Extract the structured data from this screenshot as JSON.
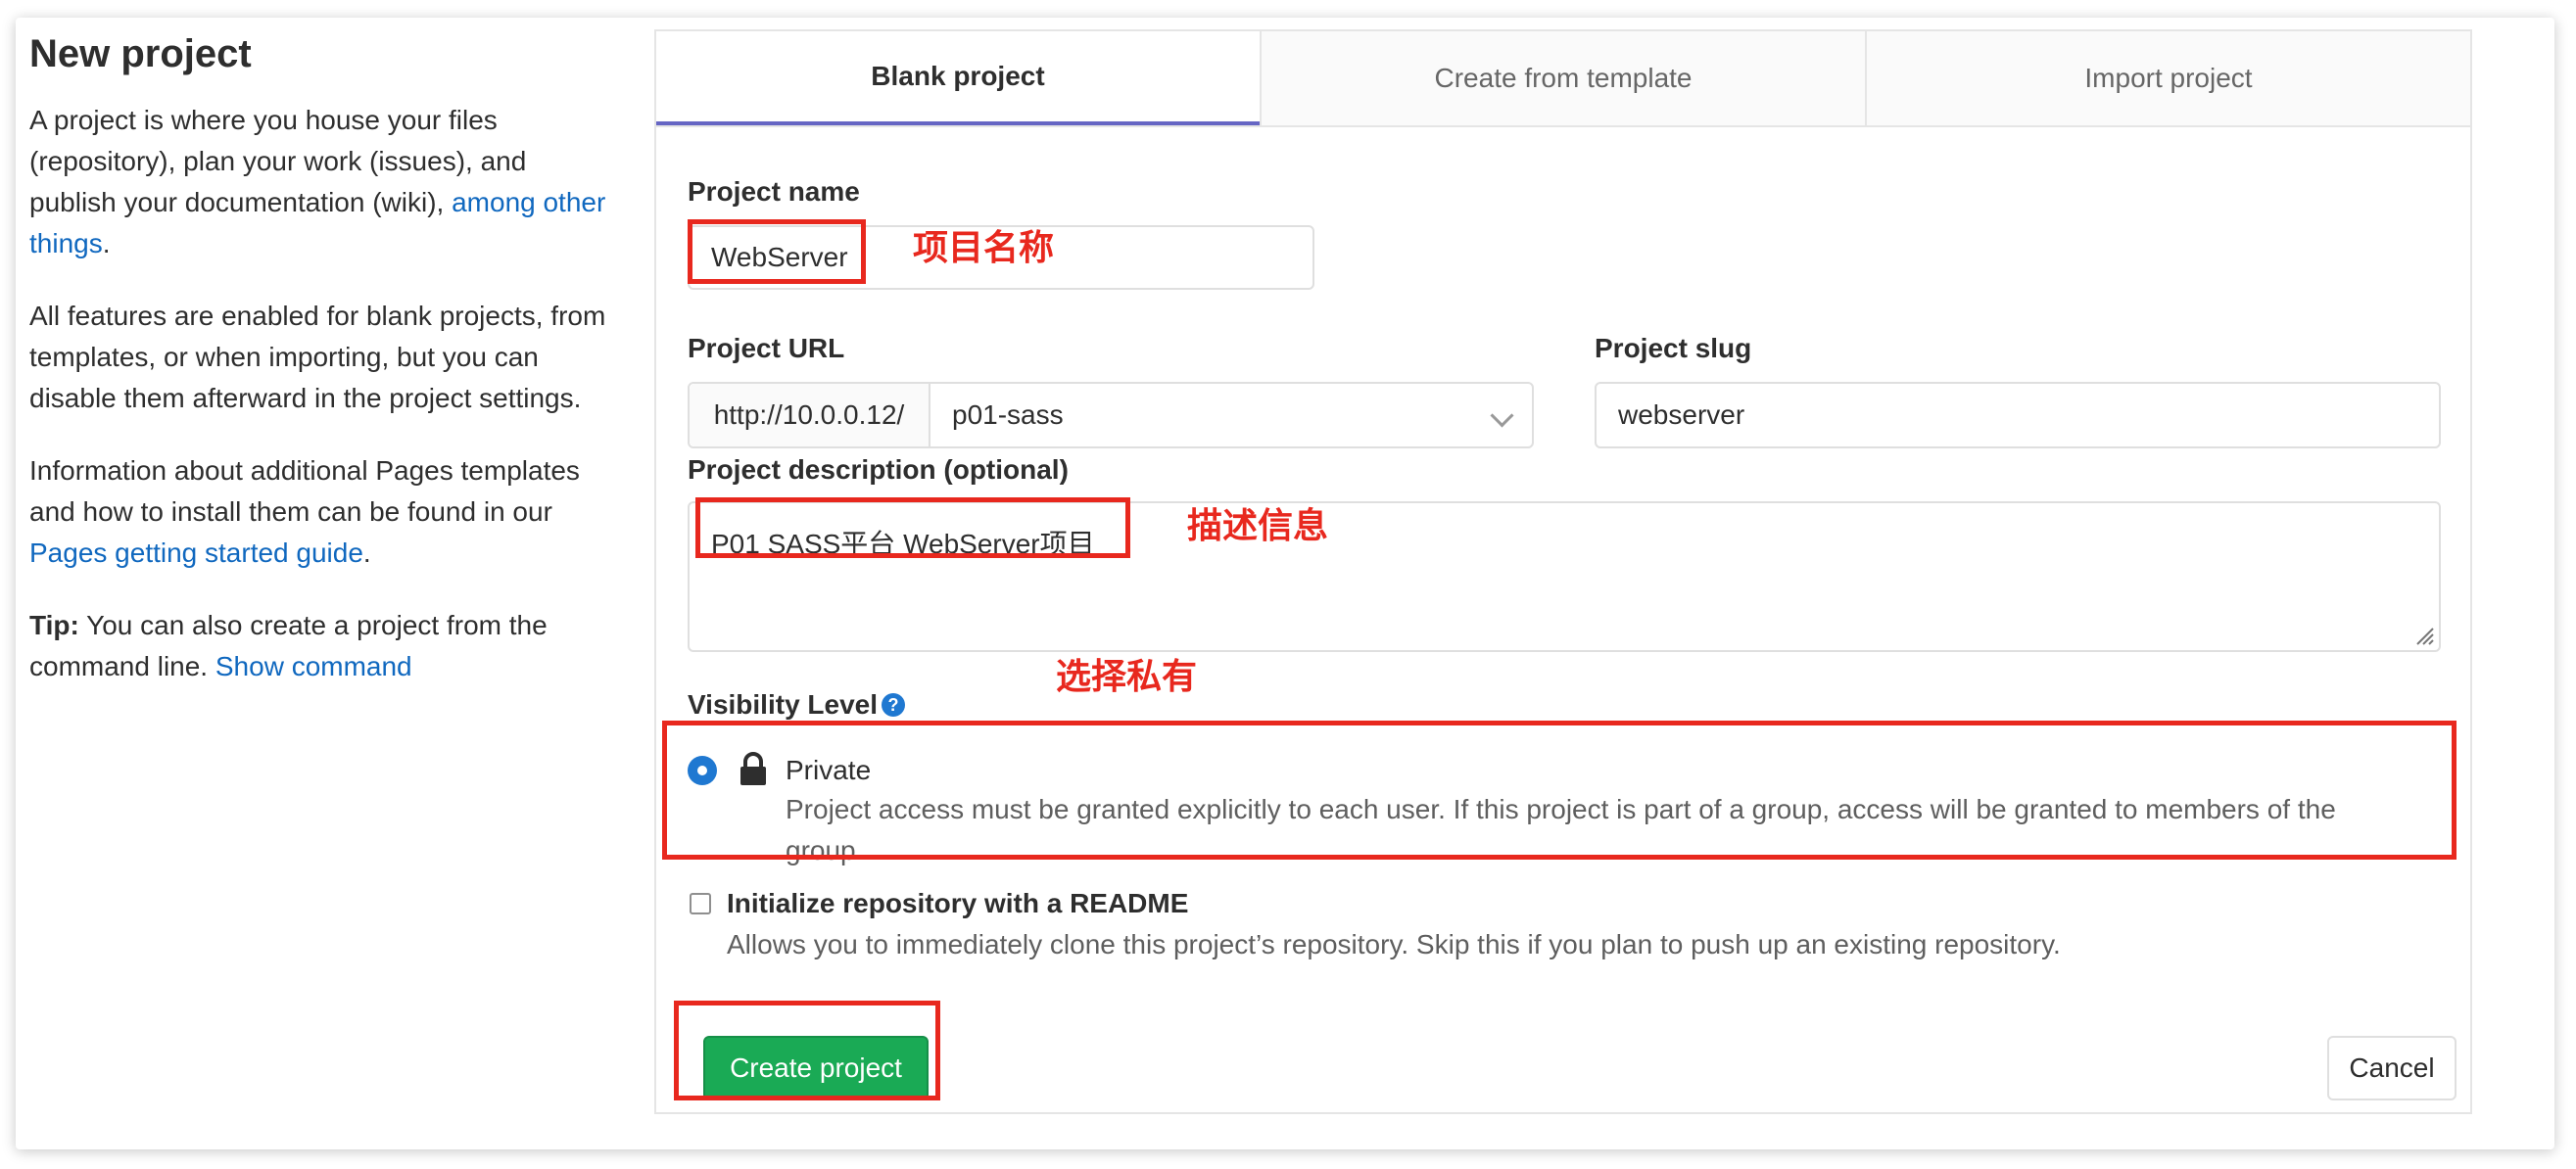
{
  "sidebar": {
    "title": "New project",
    "p1_text": "A project is where you house your files (repository), plan your work (issues), and publish your documentation (wiki),",
    "p1_link": "among other things",
    "p1_end": ".",
    "p2_text": "All features are enabled for blank projects, from templates, or when importing, but you can disable them afterward in the project settings.",
    "p3_text": "Information about additional Pages templates and how to install them can be found in our",
    "p3_link": "Pages getting started guide",
    "p3_end": ".",
    "tip_label": "Tip:",
    "tip_text": "You can also create a project from the command line.",
    "tip_link": "Show command"
  },
  "tabs": [
    "Blank project",
    "Create from template",
    "Import project"
  ],
  "form": {
    "project_name_label": "Project name",
    "project_name_value": "WebServer",
    "project_url_label": "Project URL",
    "project_url_prefix": "http://10.0.0.12/",
    "project_url_namespace": "p01-sass",
    "project_slug_label": "Project slug",
    "project_slug_value": "webserver",
    "description_label": "Project description (optional)",
    "description_value": "P01 SASS平台 WebServer项目",
    "visibility_label": "Visibility Level",
    "visibility_help_icon": "?",
    "visibility_option": "Private",
    "visibility_description_line1": "Project access must be granted explicitly to each user. If this project is part of a group, access will be granted to members of the",
    "visibility_description_line2": "group.",
    "readme_label": "Initialize repository with a README",
    "readme_description": "Allows you to immediately clone this project’s repository. Skip this if you plan to push up an existing repository.",
    "create_button": "Create project",
    "cancel_button": "Cancel"
  },
  "annotations": {
    "name_note": "项目名称",
    "description_note": "描述信息",
    "visibility_note": "选择私有",
    "color": "#e8281e"
  },
  "icons": {
    "lock": "lock-icon",
    "help": "question-circle-icon",
    "chevron": "chevron-down-icon"
  }
}
